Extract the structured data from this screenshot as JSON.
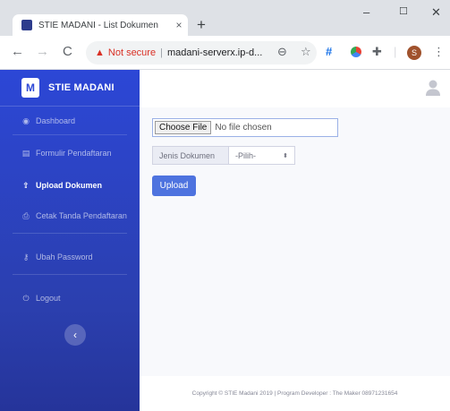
{
  "browser": {
    "tab_title": "STIE MADANI - List Dokumen",
    "tab_close": "×",
    "new_tab": "+",
    "window_controls": {
      "minimize": "–",
      "maximize": "☐",
      "close": "✕"
    },
    "nav": {
      "back": "←",
      "forward": "→",
      "reload": "C"
    },
    "not_secure_label": "Not secure",
    "separator": "|",
    "url": "madani-serverx.ip-d...",
    "profile_initial": "S",
    "toolbar_icons": [
      "zoom-icon",
      "star-icon",
      "hash-extension-icon",
      "color-extension-icon",
      "puzzle-icon",
      "profile-avatar",
      "menu-icon"
    ]
  },
  "brand": {
    "logo_text": "M",
    "name": "STIE MADANI"
  },
  "sidebar": {
    "items": [
      {
        "label": "Dashboard",
        "icon": "dashboard-icon"
      },
      {
        "label": "Formulir Pendaftaran",
        "icon": "form-icon"
      },
      {
        "label": "Upload Dokumen",
        "icon": "upload-icon",
        "active": true
      },
      {
        "label": "Cetak Tanda Pendaftaran",
        "icon": "print-icon"
      },
      {
        "label": "Ubah Password",
        "icon": "key-icon"
      },
      {
        "label": "Logout",
        "icon": "power-icon"
      }
    ],
    "collapse_symbol": "‹"
  },
  "form": {
    "choose_file_label": "Choose File",
    "no_file_text": "No file chosen",
    "jenis_label": "Jenis Dokumen",
    "jenis_selected": "-Pilih-",
    "upload_label": "Upload"
  },
  "footer": {
    "text": "Copyright © STIE Madani 2019 | Program Developer : The Maker 08971231654"
  },
  "colors": {
    "sidebar_top": "#2c47d6",
    "sidebar_bottom": "#25349a",
    "primary_button": "#4e73df",
    "not_secure": "#d93025"
  }
}
